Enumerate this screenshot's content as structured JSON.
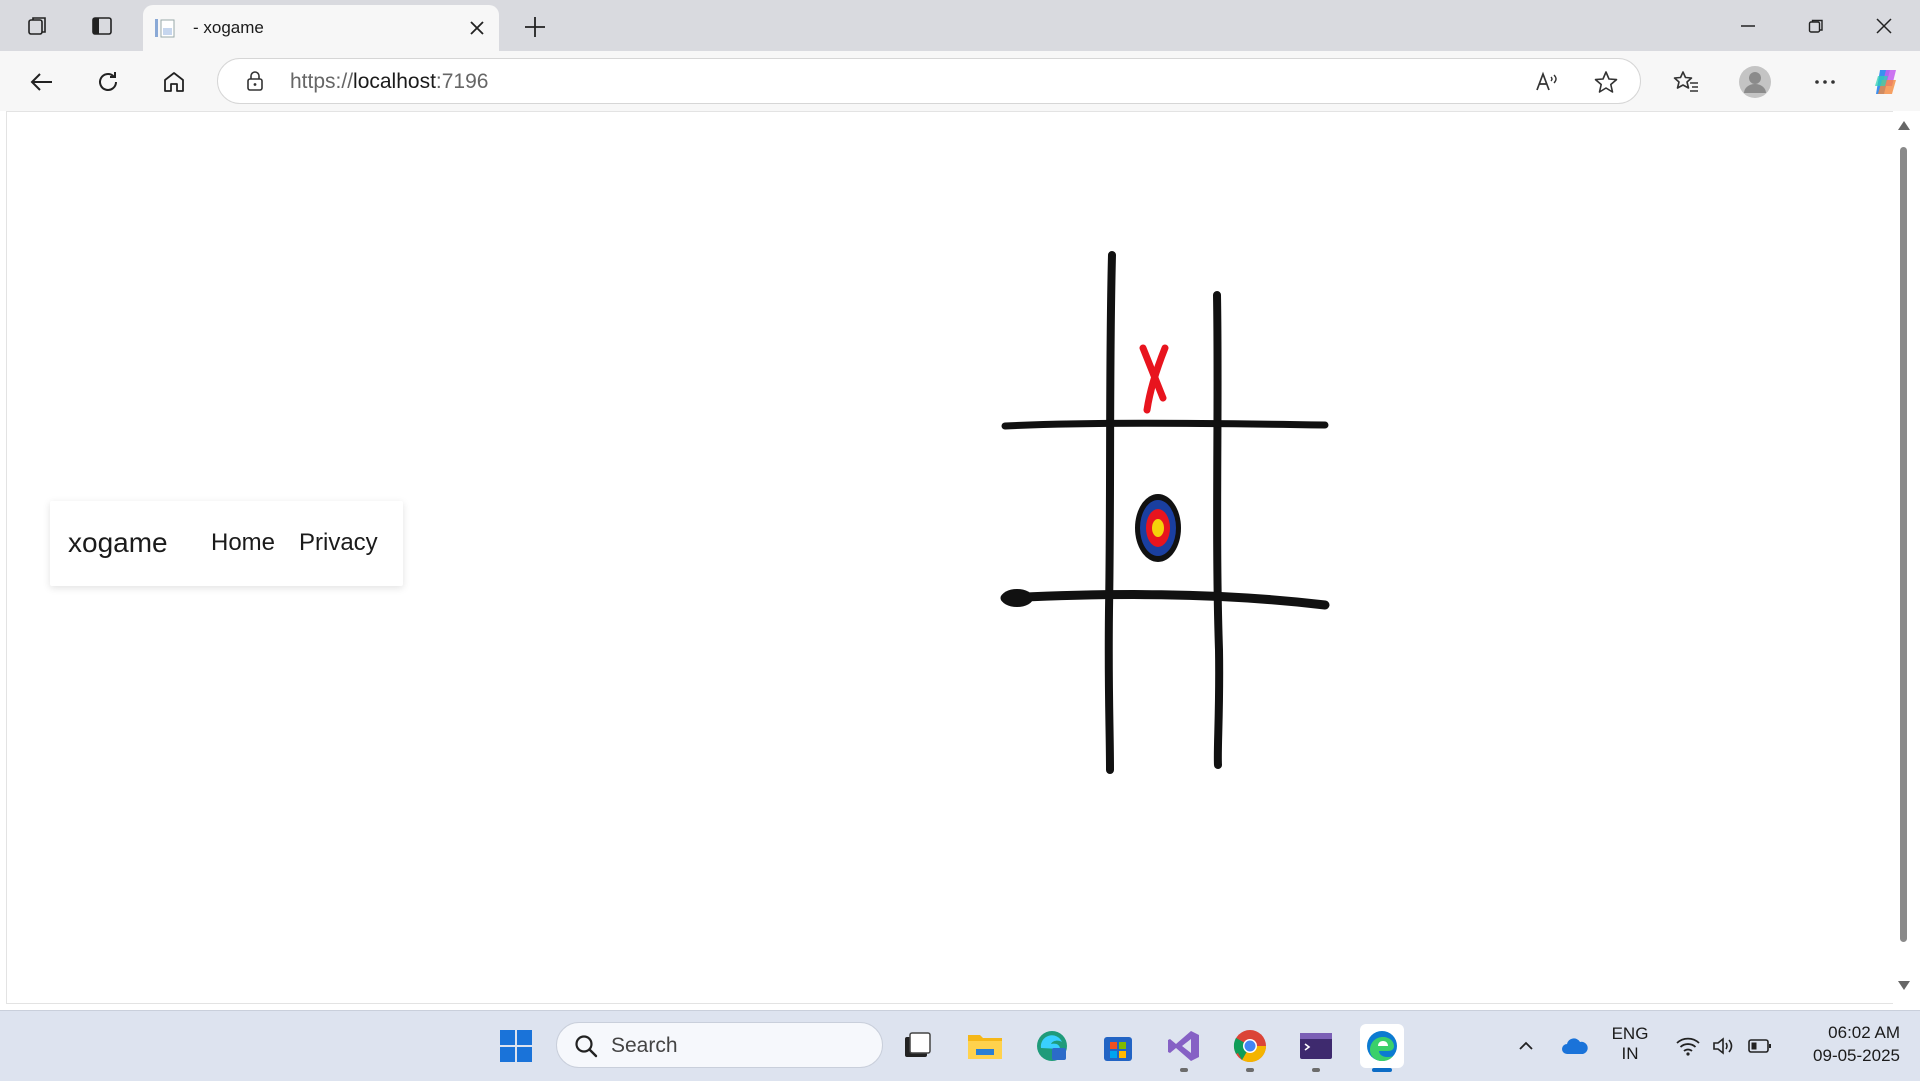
{
  "browser": {
    "tab": {
      "title": "- xogame"
    },
    "address": {
      "scheme": "https://",
      "host": "localhost",
      "port": ":7196"
    }
  },
  "page": {
    "nav": {
      "brand": "xogame",
      "home": "Home",
      "privacy": "Privacy"
    },
    "board": {
      "marks": [
        {
          "cell": "top-middle",
          "symbol": "X",
          "color": "#e8141e"
        },
        {
          "cell": "center",
          "symbol": "O",
          "color": "#1a3fa0"
        }
      ]
    }
  },
  "taskbar": {
    "search_placeholder": "Search",
    "language": {
      "line1": "ENG",
      "line2": "IN"
    },
    "clock": {
      "time": "06:02 AM",
      "date": "09-05-2025"
    }
  },
  "colors": {
    "titlebar": "#d9dadf",
    "toolbar": "#f7f7f7",
    "taskbar": "#dde3ef",
    "x_mark": "#e8141e"
  }
}
